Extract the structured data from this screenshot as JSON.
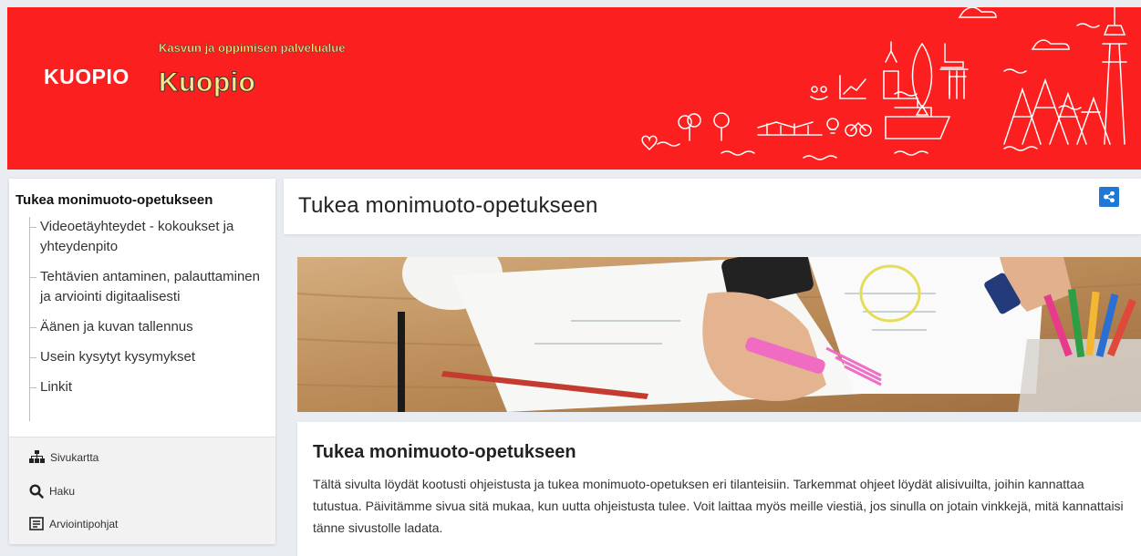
{
  "header": {
    "logo": "KUOPIO",
    "subtitle": "Kasvun ja oppimisen palvelualue",
    "site_title": "Kuopio"
  },
  "sidebar": {
    "title": "Tukea monimuoto-opetukseen",
    "items": [
      {
        "label": "Videoetäyhteydet - kokoukset ja yhteydenpito"
      },
      {
        "label": "Tehtävien antaminen, palauttaminen ja arviointi digitaalisesti"
      },
      {
        "label": "Äänen ja kuvan tallennus"
      },
      {
        "label": "Usein kysytyt kysymykset"
      },
      {
        "label": "Linkit"
      }
    ],
    "tools": [
      {
        "label": "Sivukartta",
        "icon": "sitemap-icon"
      },
      {
        "label": "Haku",
        "icon": "search-icon"
      },
      {
        "label": "Arviointipohjat",
        "icon": "document-icon"
      }
    ]
  },
  "main": {
    "page_title": "Tukea monimuoto-opetukseen",
    "share_icon": "share-icon",
    "content_title": "Tukea monimuoto-opetukseen",
    "content_text": "Tältä sivulta löydät kootusti ohjeistusta ja tukea monimuoto-opetuksen eri tilanteisiin. Tarkemmat ohjeet löydät alisivuilta, joihin kannattaa tutustua. Päivitämme sivua sitä mukaa, kun uutta ohjeistusta tulee. Voit laittaa myös meille viestiä, jos sinulla on jotain vinkkejä, mitä kannattaisi tänne sivustolle ladata."
  },
  "colors": {
    "banner": "#fb1f1f",
    "title_yellow": "#ffe680",
    "accent_blue": "#1f78d6"
  }
}
